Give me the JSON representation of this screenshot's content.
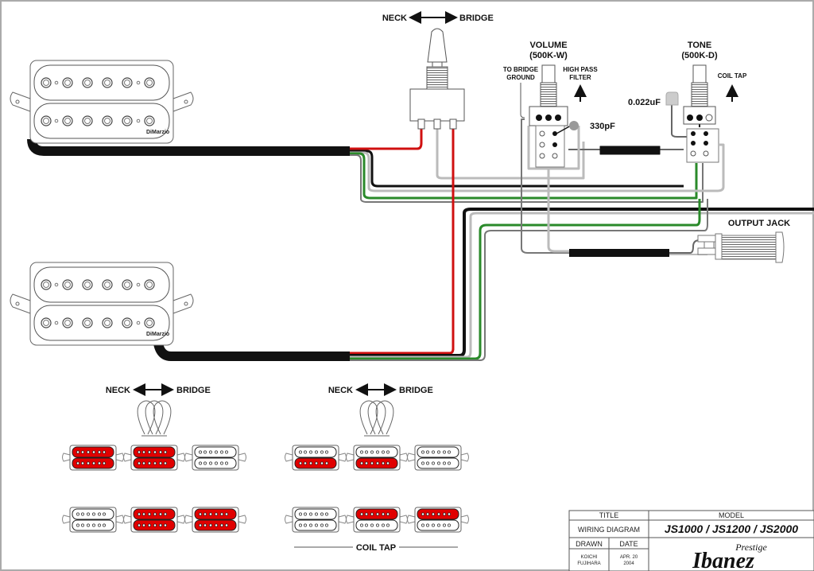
{
  "diagram": {
    "title": "Wiring Diagram",
    "switch": {
      "label_left": "NECK",
      "label_right": "BRIDGE"
    },
    "volume_pot": {
      "name": "VOLUME",
      "value": "(500K-W)",
      "ground_note_line1": "TO BRIDGE",
      "ground_note_line2": "GROUND",
      "filter_note_line1": "HIGH PASS",
      "filter_note_line2": "FILTER",
      "capacitor": "330pF"
    },
    "tone_pot": {
      "name": "TONE",
      "value": "(500K-D)",
      "pull_note": "COIL TAP",
      "capacitor": "0.022uF"
    },
    "output_jack": {
      "label": "OUTPUT JACK"
    },
    "pickups": [
      {
        "position": "neck",
        "brand": "DiMarzio"
      },
      {
        "position": "bridge",
        "brand": "DiMarzio"
      }
    ],
    "wire_colors": {
      "red": "#d01010",
      "green": "#2a8a2a",
      "black": "#111111",
      "bare": "#bbbbbb",
      "highlight": "#e00000"
    },
    "positions_legend": [
      {
        "label_left": "NECK",
        "label_right": "BRIDGE",
        "mode": "humbucker",
        "rows": [
          [
            {
              "top": true,
              "bottom": true
            },
            {
              "top": true,
              "bottom": true
            },
            {
              "top": false,
              "bottom": false
            }
          ],
          [
            {
              "top": false,
              "bottom": false
            },
            {
              "top": true,
              "bottom": true
            },
            {
              "top": true,
              "bottom": true
            }
          ]
        ]
      },
      {
        "label_left": "NECK",
        "label_right": "BRIDGE",
        "mode": "coil tap",
        "caption": "COIL TAP",
        "rows": [
          [
            {
              "top": false,
              "bottom": true
            },
            {
              "top": false,
              "bottom": true
            },
            {
              "top": false,
              "bottom": false
            }
          ],
          [
            {
              "top": false,
              "bottom": false
            },
            {
              "top": true,
              "bottom": false
            },
            {
              "top": true,
              "bottom": false
            }
          ]
        ]
      }
    ]
  },
  "title_block": {
    "title_header": "TITLE",
    "title_value": "WIRING DIAGRAM",
    "model_header": "MODEL",
    "model_value": "JS1000 / JS1200 / JS2000",
    "drawn_header": "DRAWN",
    "drawn_line1": "KOICHI",
    "drawn_line2": "FUJIHARA",
    "date_header": "DATE",
    "date_line1": "APR. 20",
    "date_line2": "2004",
    "brand": "Ibanez",
    "brand_sub": "Prestige"
  }
}
